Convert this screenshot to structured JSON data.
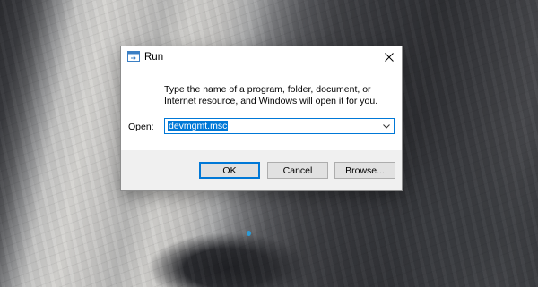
{
  "dialog": {
    "title": "Run",
    "description": "Type the name of a program, folder, document, or Internet resource, and Windows will open it for you.",
    "open_label": "Open:",
    "open_value": "devmgmt.msc",
    "buttons": {
      "ok": "OK",
      "cancel": "Cancel",
      "browse": "Browse..."
    }
  },
  "icons": {
    "title": "run-icon",
    "close": "close-icon",
    "dropdown": "chevron-down-icon"
  },
  "colors": {
    "accent": "#0078d7",
    "footer_bg": "#f0f0f0",
    "button_bg": "#e1e1e1"
  }
}
